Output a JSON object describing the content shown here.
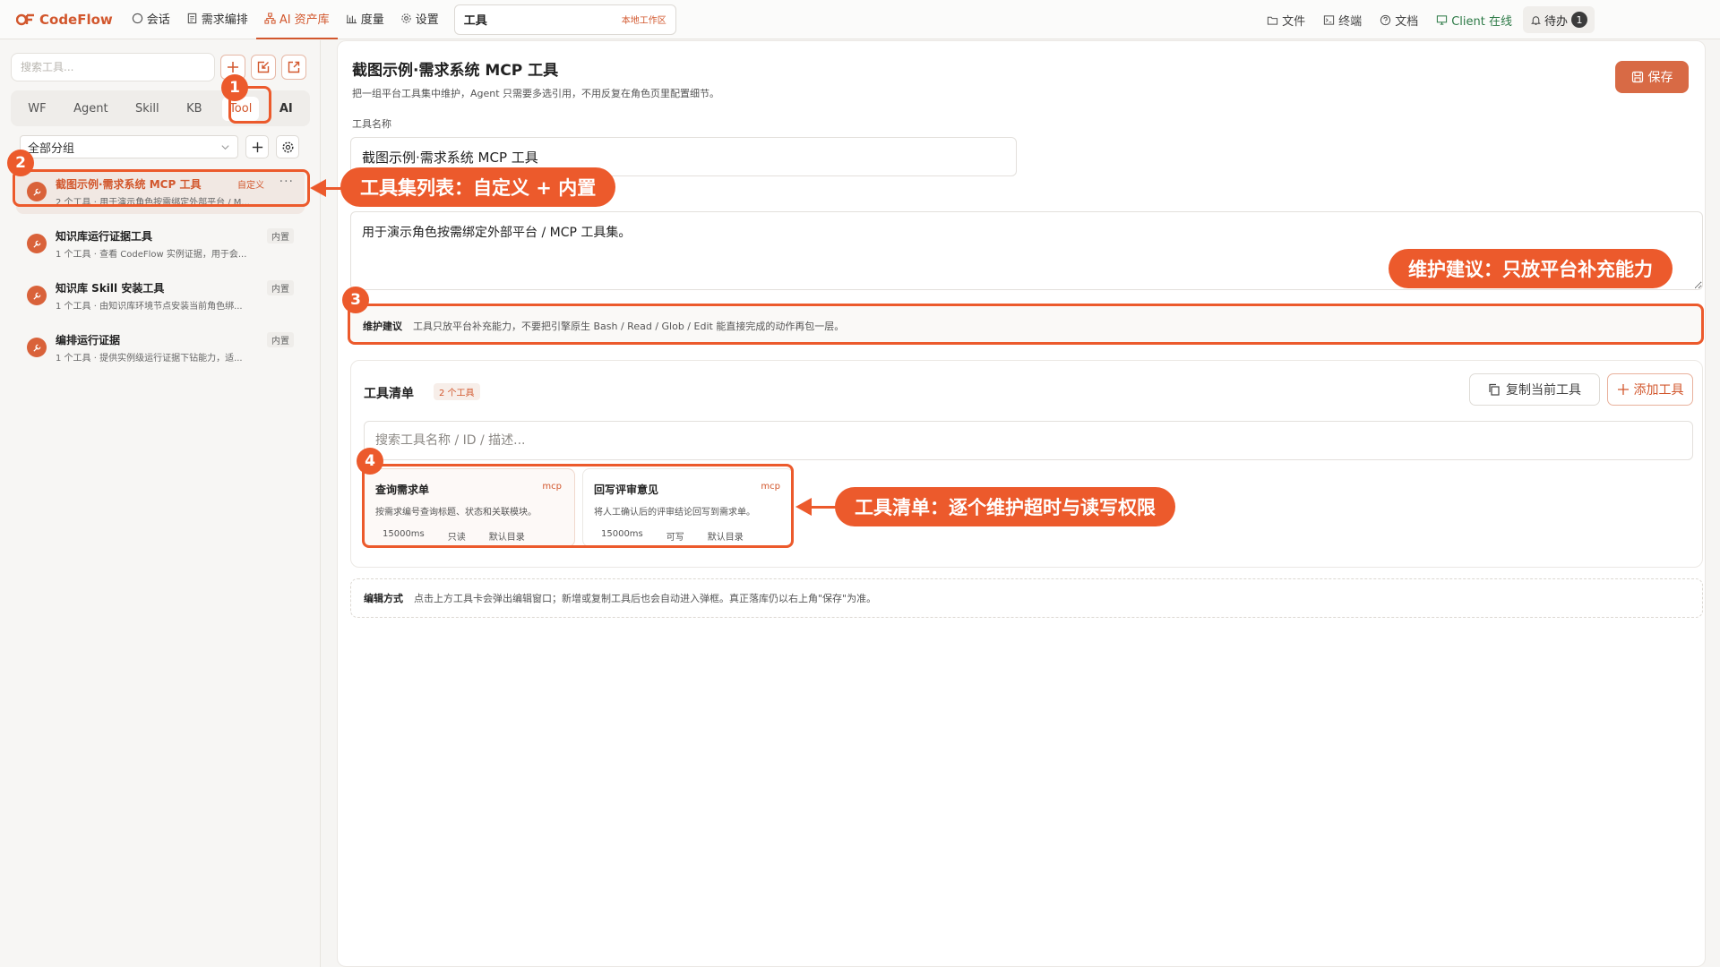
{
  "app": {
    "brand": "CodeFlow"
  },
  "nav": {
    "items": [
      {
        "label": "会话",
        "icon": "chat-bubble-icon"
      },
      {
        "label": "需求编排",
        "icon": "document-icon"
      },
      {
        "label": "AI 资产库",
        "icon": "sitemap-icon",
        "active": true
      },
      {
        "label": "度量",
        "icon": "bar-chart-icon"
      },
      {
        "label": "设置",
        "icon": "gear-icon"
      }
    ],
    "open_tab": {
      "label": "工具",
      "workspace": "本地工作区"
    }
  },
  "nav_right": {
    "files": "文件",
    "terminal": "终端",
    "docs": "文档",
    "client": "Client 在线",
    "todo": "待办",
    "todo_count": "1"
  },
  "sidebar": {
    "search_placeholder": "搜索工具...",
    "type_tabs": [
      "WF",
      "Agent",
      "Skill",
      "KB",
      "Tool",
      "AI"
    ],
    "active_type": "Tool",
    "group_select": "全部分组",
    "tools": [
      {
        "name": "截图示例·需求系统 MCP 工具",
        "desc": "2 个工具 · 用于演示角色按需绑定外部平台 / M...",
        "tag": "自定义",
        "selected": true
      },
      {
        "name": "知识库运行证据工具",
        "desc": "1 个工具 · 查看 CodeFlow 实例证据，用于会...",
        "tag": "内置"
      },
      {
        "name": "知识库 Skill 安装工具",
        "desc": "1 个工具 · 由知识库环境节点安装当前角色绑...",
        "tag": "内置"
      },
      {
        "name": "编排运行证据",
        "desc": "1 个工具 · 提供实例级运行证据下钻能力，适...",
        "tag": "内置"
      }
    ]
  },
  "main": {
    "title": "截图示例·需求系统 MCP 工具",
    "subtitle": "把一组平台工具集中维护，Agent 只需要多选引用，不用反复在角色页里配置细节。",
    "save_label": "保存",
    "name_label": "工具名称",
    "name_value": "截图示例·需求系统 MCP 工具",
    "description": "用于演示角色按需绑定外部平台 / MCP 工具集。",
    "tip_label": "维护建议",
    "tip_text": "工具只放平台补充能力，不要把引擎原生 Bash / Read / Glob / Edit 能直接完成的动作再包一层。",
    "tools_title": "工具清单",
    "tools_count": "2 个工具",
    "copy_label": "复制当前工具",
    "add_label": "添加工具",
    "tool_search_placeholder": "搜索工具名称 / ID / 描述...",
    "cards": [
      {
        "name": "查询需求单",
        "type": "mcp",
        "desc": "按需求编号查询标题、状态和关联模块。",
        "timeout": "15000ms",
        "perm": "只读",
        "dir": "默认目录"
      },
      {
        "name": "回写评审意见",
        "type": "mcp",
        "desc": "将人工确认后的评审结论回写到需求单。",
        "timeout": "15000ms",
        "perm": "可写",
        "dir": "默认目录"
      }
    ],
    "edit_label": "编辑方式",
    "edit_text": "点击上方工具卡会弹出编辑窗口；新增或复制工具后也会自动进入弹框。真正落库仍以右上角\"保存\"为准。"
  },
  "annotations": {
    "n1": "1",
    "n2": "2",
    "n3": "3",
    "n4": "4",
    "callout_list": "工具集列表：自定义 + 内置",
    "callout_tip": "维护建议：只放平台补充能力",
    "callout_tools": "工具清单：逐个维护超时与读写权限",
    "color": "#ec5a2c"
  }
}
